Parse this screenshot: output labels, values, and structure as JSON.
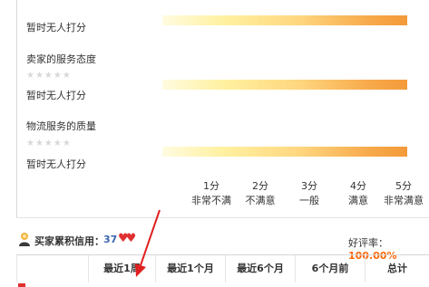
{
  "ratings": [
    {
      "label": "",
      "no_rating_text": "暂时无人打分"
    },
    {
      "label": "卖家的服务态度",
      "no_rating_text": "暂时无人打分"
    },
    {
      "label": "物流服务的质量",
      "no_rating_text": "暂时无人打分"
    }
  ],
  "stars_placeholder": "★★★★★",
  "scale": [
    {
      "score": "1分",
      "label": "非常不满"
    },
    {
      "score": "2分",
      "label": "不满意"
    },
    {
      "score": "3分",
      "label": "一般"
    },
    {
      "score": "4分",
      "label": "满意"
    },
    {
      "score": "5分",
      "label": "非常满意"
    }
  ],
  "credit": {
    "label": "买家累积信用：",
    "score": "37",
    "badge_icon": "heart-icon",
    "good_rate_label": "好评率：",
    "good_rate_value": "100.00%"
  },
  "history_table": {
    "headers": [
      "最近1周",
      "最近1个月",
      "最近6个月",
      "6个月前",
      "总计"
    ]
  },
  "colors": {
    "accent": "#ff6600",
    "credit_score": "#3a66b3",
    "heart": "#e03030",
    "annotation_arrow": "#e02020"
  }
}
